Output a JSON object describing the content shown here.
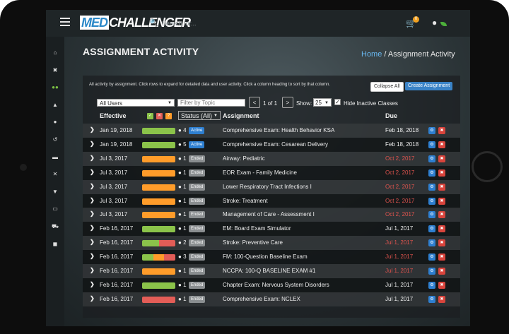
{
  "topbar": {
    "logo_prefix": "MED",
    "logo_suffix": "CHALLENGER",
    "search_placeholder": "Search for...",
    "cart_count": "0"
  },
  "sidebar": {
    "items": [
      {
        "icon": "home-icon",
        "glyph": "⌂"
      },
      {
        "icon": "tools-icon",
        "glyph": "✖"
      },
      {
        "icon": "users-icon",
        "glyph": "●●"
      },
      {
        "icon": "graduation-cap-icon",
        "glyph": "▲"
      },
      {
        "icon": "bell-icon",
        "glyph": "●"
      },
      {
        "icon": "history-icon",
        "glyph": "↺"
      },
      {
        "icon": "book-icon",
        "glyph": "▬"
      },
      {
        "icon": "wrench-icon",
        "glyph": "✕"
      },
      {
        "icon": "trophy-icon",
        "glyph": "▼"
      },
      {
        "icon": "id-card-icon",
        "glyph": "▭"
      },
      {
        "icon": "cart-icon",
        "glyph": "⛟"
      },
      {
        "icon": "truck-icon",
        "glyph": "◼"
      }
    ]
  },
  "page": {
    "title": "ASSIGNMENT ACTIVITY",
    "breadcrumb_home": "Home",
    "breadcrumb_sep": "/",
    "breadcrumb_current": "Assignment Activity"
  },
  "panel": {
    "info": "All activity by assignment. Click rows to expand for detailed data and user activity. Click a column heading to sort by that column.",
    "collapse_all": "Collapse All",
    "create_assignment": "Create Assignment"
  },
  "filters": {
    "users_selected": "All Users",
    "topic_placeholder": "Filter by Topic",
    "prev": "<",
    "page_label": "1 of 1",
    "next": ">",
    "show_label": "Show:",
    "show_value": "25",
    "hide_inactive_label": "Hide Inactive Classes",
    "hide_inactive_checked": true
  },
  "columns": {
    "effective": "Effective",
    "mini_green": "✓",
    "mini_red": "✕",
    "mini_orange": "?",
    "status": "Status (All)",
    "assignment": "Assignment",
    "due": "Due"
  },
  "colors": {
    "green": "#8bc34a",
    "orange": "#ff9c2a",
    "red": "#e35d57",
    "late_due": "#e0544e",
    "active_badge": "#2e7fd0",
    "ended_badge": "#8a8e90"
  },
  "rows": [
    {
      "effective": "Jan 19, 2018",
      "progress": {
        "green": 1.0,
        "orange": 0,
        "red": 0
      },
      "count": "4",
      "status": "Active",
      "assignment": "Comprehensive Exam: Health Behavior KSA",
      "due": "Feb 18, 2018",
      "late": false
    },
    {
      "effective": "Jan 19, 2018",
      "progress": {
        "green": 1.0,
        "orange": 0,
        "red": 0
      },
      "count": "5",
      "status": "Active",
      "assignment": "Comprehensive Exam: Cesarean Delivery",
      "due": "Feb 18, 2018",
      "late": false
    },
    {
      "effective": "Jul 3, 2017",
      "progress": {
        "green": 0,
        "orange": 1.0,
        "red": 0
      },
      "count": "1",
      "status": "Ended",
      "assignment": "Airway: Pediatric",
      "due": "Oct 2, 2017",
      "late": true
    },
    {
      "effective": "Jul 3, 2017",
      "progress": {
        "green": 0,
        "orange": 1.0,
        "red": 0
      },
      "count": "1",
      "status": "Ended",
      "assignment": "EOR Exam - Family Medicine",
      "due": "Oct 2, 2017",
      "late": true
    },
    {
      "effective": "Jul 3, 2017",
      "progress": {
        "green": 0,
        "orange": 1.0,
        "red": 0
      },
      "count": "1",
      "status": "Ended",
      "assignment": "Lower Respiratory Tract Infections I",
      "due": "Oct 2, 2017",
      "late": true
    },
    {
      "effective": "Jul 3, 2017",
      "progress": {
        "green": 0,
        "orange": 1.0,
        "red": 0
      },
      "count": "1",
      "status": "Ended",
      "assignment": "Stroke: Treatment",
      "due": "Oct 2, 2017",
      "late": true
    },
    {
      "effective": "Jul 3, 2017",
      "progress": {
        "green": 0,
        "orange": 1.0,
        "red": 0
      },
      "count": "1",
      "status": "Ended",
      "assignment": "Management of Care - Assessment I",
      "due": "Oct 2, 2017",
      "late": true
    },
    {
      "effective": "Feb 16, 2017",
      "progress": {
        "green": 1.0,
        "orange": 0,
        "red": 0
      },
      "count": "1",
      "status": "Ended",
      "assignment": "EM: Board Exam Simulator",
      "due": "Jul 1, 2017",
      "late": false
    },
    {
      "effective": "Feb 16, 2017",
      "progress": {
        "green": 0.5,
        "orange": 0,
        "red": 0.5
      },
      "count": "2",
      "status": "Ended",
      "assignment": "Stroke: Preventive Care",
      "due": "Jul 1, 2017",
      "late": true
    },
    {
      "effective": "Feb 16, 2017",
      "progress": {
        "green": 0.34,
        "orange": 0.33,
        "red": 0.33
      },
      "count": "3",
      "status": "Ended",
      "assignment": "FM: 100-Question Baseline Exam",
      "due": "Jul 1, 2017",
      "late": true
    },
    {
      "effective": "Feb 16, 2017",
      "progress": {
        "green": 0,
        "orange": 1.0,
        "red": 0
      },
      "count": "1",
      "status": "Ended",
      "assignment": "NCCPA: 100-Q BASELINE EXAM #1",
      "due": "Jul 1, 2017",
      "late": true
    },
    {
      "effective": "Feb 16, 2017",
      "progress": {
        "green": 1.0,
        "orange": 0,
        "red": 0
      },
      "count": "1",
      "status": "Ended",
      "assignment": "Chapter Exam: Nervous System Disorders",
      "due": "Jul 1, 2017",
      "late": false
    },
    {
      "effective": "Feb 16, 2017",
      "progress": {
        "green": 0,
        "orange": 0,
        "red": 1.0
      },
      "count": "1",
      "status": "Ended",
      "assignment": "Comprehensive Exam: NCLEX",
      "due": "Jul 1, 2017",
      "late": false
    }
  ]
}
